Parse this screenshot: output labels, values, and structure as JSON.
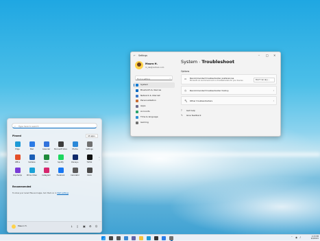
{
  "settings": {
    "title": "Settings",
    "profile": {
      "name": "Mauro H.",
      "email": "m_lab@outlook.com"
    },
    "search_placeholder": "Find a setting",
    "nav": [
      {
        "label": "System",
        "selected": true,
        "color": "#0078d4"
      },
      {
        "label": "Bluetooth & devices",
        "color": "#0067c0"
      },
      {
        "label": "Network & internet",
        "color": "#3a78c9"
      },
      {
        "label": "Personalization",
        "color": "#c86d33"
      },
      {
        "label": "Apps",
        "color": "#6b6b8c"
      },
      {
        "label": "Accounts",
        "color": "#2aa26b"
      },
      {
        "label": "Time & language",
        "color": "#2d8ed4"
      },
      {
        "label": "Gaming",
        "color": "#6f6f6f"
      }
    ],
    "breadcrumb": {
      "parent": "System",
      "separator": "›",
      "current": "Troubleshoot"
    },
    "options_label": "Options",
    "cards": [
      {
        "title": "Recommended troubleshooter preferences",
        "subtitle": "Microsoft can recommend and run troubleshooters for your devices",
        "dropdown": "Don't run any",
        "icon": "chat-icon"
      },
      {
        "title": "Recommended troubleshooter history",
        "icon": "history-icon"
      },
      {
        "title": "Other troubleshooters",
        "icon": "wrench-icon"
      }
    ],
    "links": [
      {
        "label": "Get help",
        "icon": "help-icon"
      },
      {
        "label": "Give feedback",
        "icon": "feedback-icon"
      }
    ]
  },
  "start": {
    "search_placeholder": "Type here to search",
    "pinned_label": "Pinned",
    "all_apps": "All apps  ›",
    "apps": [
      {
        "label": "Edge",
        "color": "#1e9ad6"
      },
      {
        "label": "Mail",
        "color": "#2c7be5"
      },
      {
        "label": "Calendar",
        "color": "#3273dc"
      },
      {
        "label": "Microsoft Store",
        "color": "#3d3d3d"
      },
      {
        "label": "Photos",
        "color": "#2b88d8"
      },
      {
        "label": "Settings",
        "color": "#707070"
      },
      {
        "label": "Office",
        "color": "#e3502a"
      },
      {
        "label": "Solitaire",
        "color": "#1c5fb6"
      },
      {
        "label": "Xbox",
        "color": "#1f8a3b"
      },
      {
        "label": "Spotify",
        "color": "#1ed760"
      },
      {
        "label": "Disney+",
        "color": "#102a6b"
      },
      {
        "label": "TikTok",
        "color": "#111111"
      },
      {
        "label": "Clipchamp",
        "color": "#7a3cd6"
      },
      {
        "label": "Prime Video",
        "color": "#1aa1d6"
      },
      {
        "label": "Instagram",
        "color": "#d6266d"
      },
      {
        "label": "Facebook",
        "color": "#1877f2"
      },
      {
        "label": "Calculator",
        "color": "#5b5b5b"
      },
      {
        "label": "Clock",
        "color": "#4a4a4a"
      }
    ],
    "recommended_label": "Recommended",
    "recommended_text": "To show your recent files and apps, turn them on in ",
    "recommended_link": "Start settings",
    "user_name": "Mauro H."
  },
  "taskbar": {
    "time": "2:23 PM",
    "date": "9/9/2021",
    "icons": [
      "windows-icon",
      "search-icon",
      "task-view-icon",
      "widgets-icon",
      "chat-icon",
      "file-explorer-icon",
      "edge-icon",
      "store-icon",
      "mail-icon",
      "settings-icon"
    ]
  }
}
